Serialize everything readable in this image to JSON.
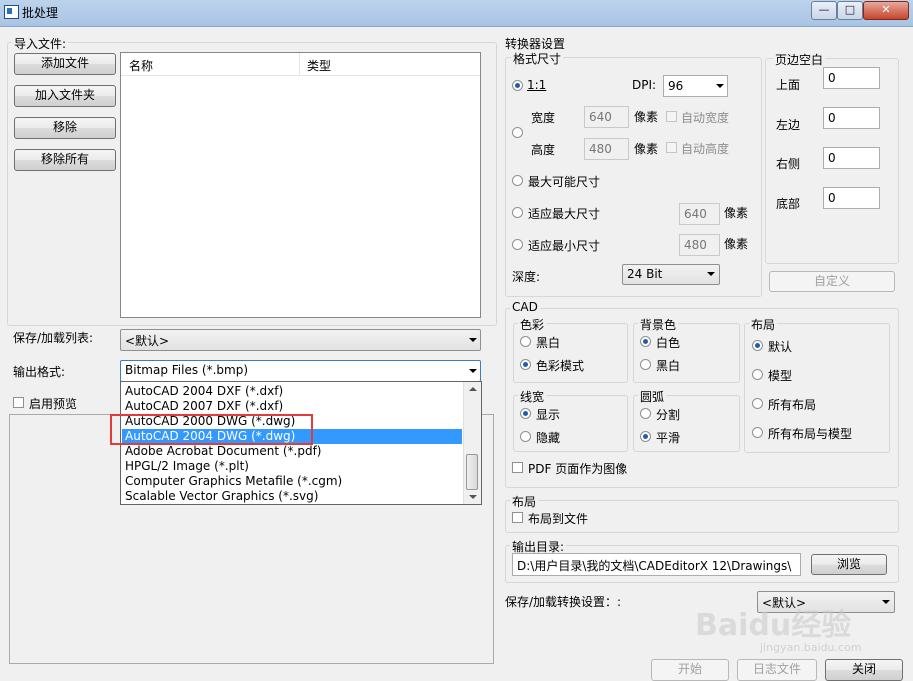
{
  "window": {
    "title": "批处理",
    "minimize": "—",
    "maximize": "□",
    "close": "✕"
  },
  "import": {
    "group_label": "导入文件:",
    "buttons": {
      "add_file": "添加文件",
      "add_folder": "加入文件夹",
      "remove": "移除",
      "remove_all": "移除所有"
    },
    "columns": [
      "名称",
      "类型"
    ]
  },
  "save_list": {
    "label": "保存/加载列表:",
    "value": "<默认>"
  },
  "output_format": {
    "label": "输出格式:",
    "value": "Bitmap Files (*.bmp)",
    "options": [
      "AutoCAD 2004 DXF (*.dxf)",
      "AutoCAD 2007 DXF (*.dxf)",
      "AutoCAD 2000 DWG (*.dwg)",
      "AutoCAD 2004 DWG (*.dwg)",
      "Adobe Acrobat Document (*.pdf)",
      "HPGL/2 Image (*.plt)",
      "Computer Graphics Metafile (*.cgm)",
      "Scalable Vector Graphics (*.svg)"
    ],
    "selected_index": 3
  },
  "enable_preview": {
    "label": "启用预览"
  },
  "converter": {
    "group_label": "转换器设置",
    "format_size": {
      "label": "格式尺寸",
      "one_to_one": "1:1",
      "dpi_label": "DPI:",
      "dpi_value": "96",
      "width_label": "宽度",
      "width_value": "640",
      "height_label": "高度",
      "height_value": "480",
      "pixel": "像素",
      "auto_width": "自动宽度",
      "auto_height": "自动高度",
      "max_possible": "最大可能尺寸",
      "fit_max": "适应最大尺寸",
      "fit_max_value": "640",
      "fit_min": "适应最小尺寸",
      "fit_min_value": "480",
      "depth_label": "深度:",
      "depth_value": "24 Bit"
    },
    "margins": {
      "label": "页边空白",
      "top": "上面",
      "top_value": "0",
      "left": "左边",
      "left_value": "0",
      "right": "右侧",
      "right_value": "0",
      "bottom": "底部",
      "bottom_value": "0",
      "custom": "自定义"
    },
    "cad": {
      "label": "CAD",
      "color": {
        "label": "色彩",
        "bw": "黑白",
        "color_mode": "色彩模式"
      },
      "background": {
        "label": "背景色",
        "white": "白色",
        "black": "黑白"
      },
      "layout": {
        "label": "布局",
        "default": "默认",
        "model": "模型",
        "all_layouts": "所有布局",
        "all_layouts_model": "所有布局与模型"
      },
      "lineweight": {
        "label": "线宽",
        "show": "显示",
        "hide": "隐藏"
      },
      "arc": {
        "label": "圆弧",
        "split": "分割",
        "smooth": "平滑"
      },
      "pdf_as_image": "PDF 页面作为图像"
    },
    "layout_group": {
      "label": "布局",
      "to_file": "布局到文件"
    },
    "output_dir": {
      "label": "输出目录:",
      "value": "D:\\用户目录\\我的文档\\CADEditorX 12\\Drawings\\",
      "browse": "浏览"
    },
    "save_settings": {
      "label": "保存/加载转换设置：:",
      "value": "<默认>"
    }
  },
  "footer": {
    "start": "开始",
    "log": "日志文件",
    "close": "关闭"
  },
  "watermark": {
    "text": "Baidu经验",
    "sub": "jingyan.baidu.com"
  }
}
